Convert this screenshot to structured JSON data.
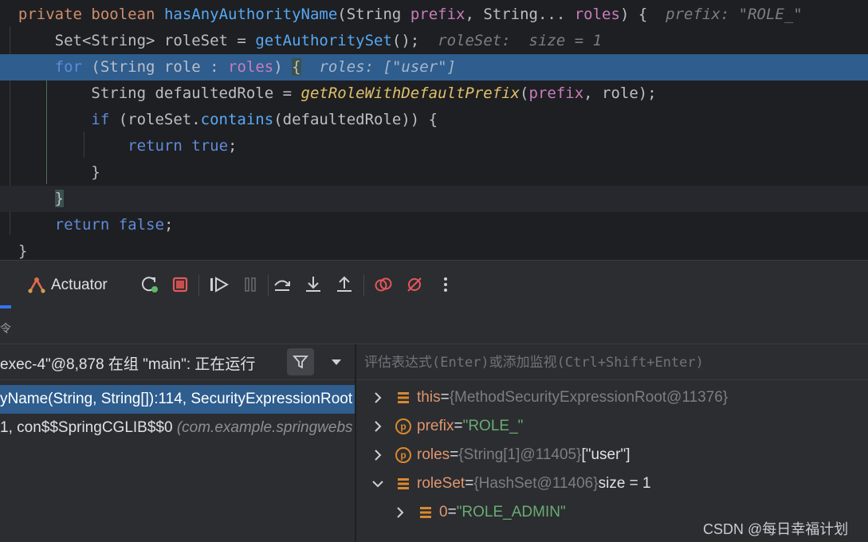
{
  "code": {
    "l1": {
      "kw1": "private",
      "kw2": "boolean",
      "fname": "hasAnyAuthorityName",
      "p1": "(String ",
      "param1": "prefix",
      "p2": ", String... ",
      "param2": "roles",
      "p3": ") {",
      "hint": "prefix: \"ROLE_\""
    },
    "l2": {
      "a": "Set<String> roleSet = ",
      "call": "getAuthoritySet",
      "b": "();",
      "hint": "roleSet:  size = 1"
    },
    "l3": {
      "kw": "for",
      "a": " (String role : ",
      "param": "roles",
      "b": ") ",
      "c": "{",
      "hint": "roles: [\"user\"]"
    },
    "l4": {
      "a": "String defaultedRole = ",
      "call": "getRoleWithDefaultPrefix",
      "b": "(",
      "param": "prefix",
      "c": ", role);"
    },
    "l5": {
      "kw": "if",
      "a": " (roleSet.",
      "call": "contains",
      "b": "(defaultedRole)) {"
    },
    "l6": {
      "kw1": "return",
      "kw2": "true",
      "a": ";"
    },
    "l7": {
      "a": "}"
    },
    "l8": {
      "a": "}"
    },
    "l9": {
      "kw1": "return",
      "kw2": "false",
      "a": ";"
    },
    "l10": {
      "a": "}"
    }
  },
  "toolbar": {
    "actuator_label": "Actuator",
    "icons": [
      "actuator-icon",
      "rerun-icon",
      "stop-icon",
      "resume-icon",
      "pause-icon",
      "step-over-icon",
      "step-into-icon",
      "step-out-icon",
      "view-breakpoints-icon",
      "mute-breakpoints-icon",
      "more-icon"
    ],
    "strip_glyph": "令"
  },
  "frames": {
    "thread": "exec-4\"@8,878 在组 \"main\": 正在运行",
    "items": [
      {
        "text": "yName(String, String[]):114, SecurityExpressionRoot",
        "selected": true
      },
      {
        "text": "1, con$$SpringCGLIB$$0 ",
        "pkg": "(com.example.springwebs"
      }
    ]
  },
  "eval": {
    "placeholder": "评估表达式(Enter)或添加监视(Ctrl+Shift+Enter)"
  },
  "variables": [
    {
      "name": "this",
      "eq": " = ",
      "type": "{MethodSecurityExpressionRoot@11376}",
      "value": "",
      "expanded": false,
      "icon": "field-icon"
    },
    {
      "name": "prefix",
      "eq": " = ",
      "type": "",
      "value": "\"ROLE_\"",
      "expanded": false,
      "icon": "parameter-icon",
      "badge": "p"
    },
    {
      "name": "roles",
      "eq": " = ",
      "type": "{String[1]@11405} ",
      "value": "[\"user\"]",
      "expanded": false,
      "icon": "parameter-icon",
      "badge": "p"
    },
    {
      "name": "roleSet",
      "eq": " = ",
      "type": "{HashSet@11406}",
      "value": "  size = 1",
      "expanded": true,
      "icon": "field-icon"
    },
    {
      "name": "0",
      "eq": " = ",
      "type": "",
      "value": "\"ROLE_ADMIN\"",
      "expanded": false,
      "icon": "field-icon"
    }
  ],
  "watermark": "CSDN @每日幸福计划",
  "colors": {
    "execution_line": "#2e5d8e",
    "selected_frame": "#2e5d8e",
    "keyword": "#cf8e6d",
    "string_value": "#6aab73",
    "var_name": "#e0956e"
  }
}
